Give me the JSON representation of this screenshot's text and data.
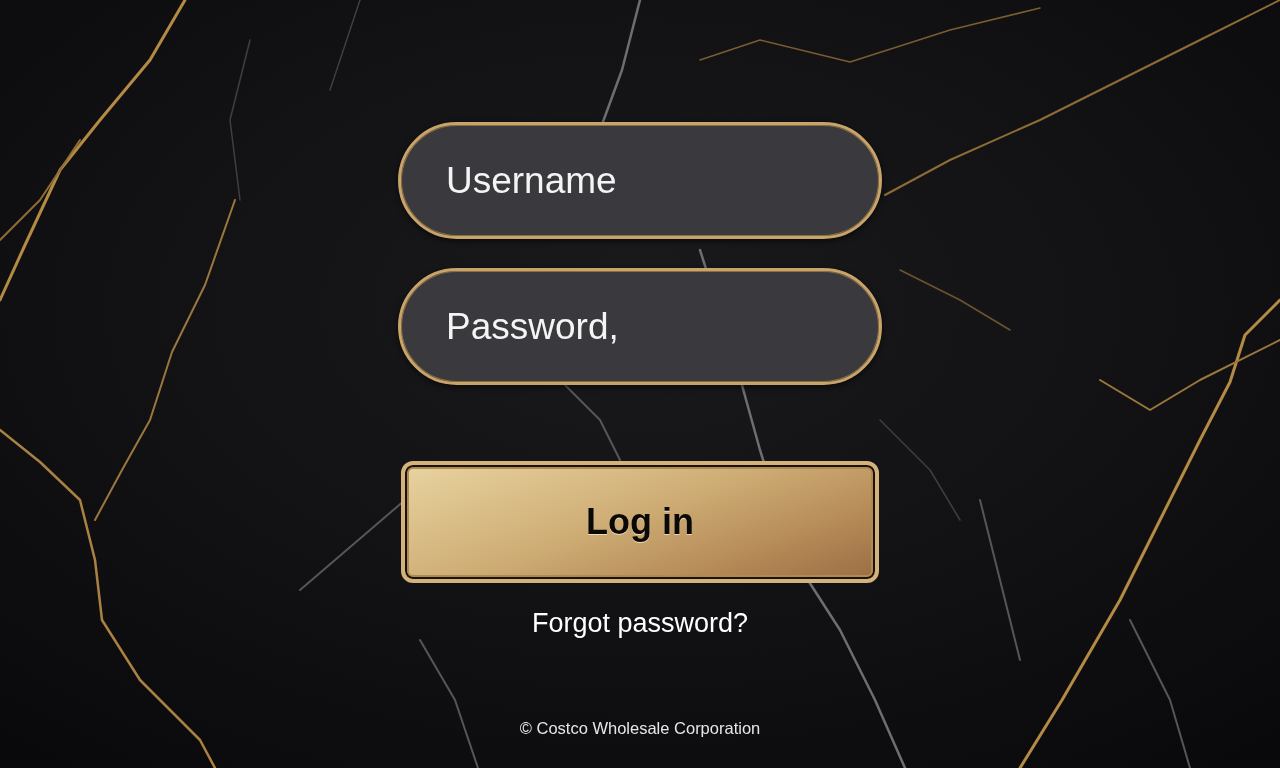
{
  "fields": [
    {
      "placeholder": "Username"
    },
    {
      "placeholder": "Password,"
    }
  ],
  "login_button": {
    "label": "Log in"
  },
  "forgot_link": {
    "label": "Forgot password?"
  },
  "footer": {
    "copyright": "© Costco Wholesale Corporation"
  }
}
